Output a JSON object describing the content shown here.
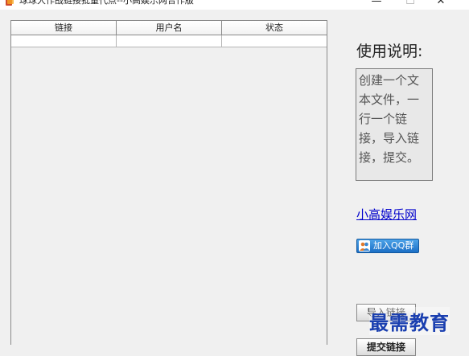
{
  "window": {
    "title": "球球大作战链接批量代点--小高娱乐网合作版",
    "minimize_glyph": "—",
    "maximize_glyph": "☐",
    "close_glyph": "✕"
  },
  "table": {
    "columns": [
      "链接",
      "用户名",
      "状态"
    ],
    "rows": [
      [
        "",
        "",
        ""
      ]
    ]
  },
  "usage": {
    "title": "使用说明:",
    "text": "创建一个文本文件，一行一个链接，导入链接，提交。"
  },
  "links": {
    "site": "小高娱乐网",
    "qq_group": "加入QQ群"
  },
  "buttons": {
    "import": "导入链接",
    "submit": "提交链接"
  },
  "watermark": "最需教育",
  "colors": {
    "link": "#0000cc",
    "qq_button": "#1b6fc6",
    "watermark": "#1a3fb0"
  },
  "icons": {
    "app": "java-cup-icon",
    "qq": "qq-people-icon"
  }
}
